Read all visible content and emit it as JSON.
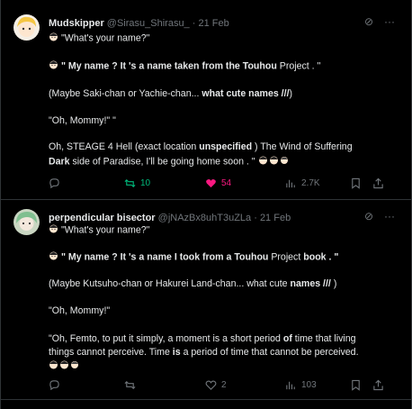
{
  "tweets": [
    {
      "display_name": "Mudskipper",
      "handle": "@Sirasu_Shirasu_",
      "date": "· 21 Feb",
      "lines": [
        {
          "segments": [
            {
              "t": "\"What's your name?\"",
              "b": false
            }
          ]
        },
        {
          "segments": [
            {
              "t": "\" My name ? It 's a name taken from the Touhou ",
              "b": true
            },
            {
              "t": "Project . \"",
              "b": false
            }
          ]
        },
        {
          "segments": [
            {
              "t": "(Maybe Saki-chan or Yachie-chan... ",
              "b": false
            },
            {
              "t": "what cute names ///",
              "b": true
            },
            {
              "t": ")",
              "b": false
            }
          ]
        },
        {
          "segments": [
            {
              "t": "\"Oh, Mommy!\" \"",
              "b": false
            }
          ]
        },
        {
          "segments": [
            {
              "t": "Oh, STEAGE 4 Hell (exact location ",
              "b": false
            },
            {
              "t": "unspecified",
              "b": true
            },
            {
              "t": " ) The Wind of Suffering",
              "b": false
            }
          ]
        },
        {
          "segments": [
            {
              "t": "Dark",
              "b": true
            },
            {
              "t": " side of Paradise, I'll be going home soon . \"",
              "b": false
            }
          ]
        }
      ],
      "actions": {
        "reply": "",
        "retweet": "10",
        "like": "54",
        "views": "2.7K"
      }
    },
    {
      "display_name": "perpendicular bisector",
      "handle": "@jNAzBx8uhT3uZLa",
      "date": "· 21 Feb",
      "lines": [
        {
          "segments": [
            {
              "t": "\"What's your name?\"",
              "b": false
            }
          ]
        },
        {
          "segments": [
            {
              "t": "\" My name ? It 's a name I took from a Touhou ",
              "b": true
            },
            {
              "t": "Project ",
              "b": false
            },
            {
              "t": "book . \"",
              "b": true
            }
          ]
        },
        {
          "segments": [
            {
              "t": "(Maybe Kutsuho-chan or Hakurei Land-chan... what cute ",
              "b": false
            },
            {
              "t": "names ///",
              "b": true
            },
            {
              "t": " )",
              "b": false
            }
          ]
        },
        {
          "segments": [
            {
              "t": "\"Oh, Mommy!\"",
              "b": false
            }
          ]
        },
        {
          "segments": [
            {
              "t": "\"Oh, Femto, to put it simply, a moment is a short period ",
              "b": false
            },
            {
              "t": "of",
              "b": true
            },
            {
              "t": " time that living",
              "b": false
            }
          ]
        },
        {
          "segments": [
            {
              "t": "things cannot perceive. Time ",
              "b": false
            },
            {
              "t": "is",
              "b": true
            },
            {
              "t": " a period of time that cannot be perceived.",
              "b": false
            }
          ]
        }
      ],
      "actions": {
        "reply": "",
        "retweet": "",
        "like": "2",
        "views": "103"
      }
    }
  ],
  "colors": {
    "background": "#000000",
    "text": "#e7e9ea",
    "muted": "#71767b",
    "retweet": "#00ba7c",
    "like": "#f91880"
  },
  "icons": [
    "grok-icon",
    "more-icon",
    "reply-icon",
    "retweet-icon",
    "heart-icon",
    "views-icon",
    "bookmark-icon",
    "share-icon"
  ]
}
